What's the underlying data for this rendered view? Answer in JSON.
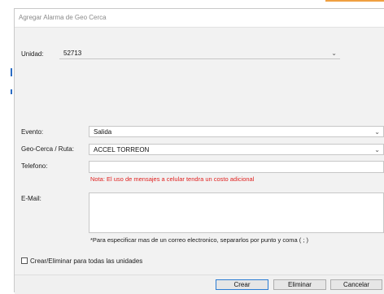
{
  "dialog": {
    "title": "Agregar Alarma de Geo Cerca",
    "unidad": {
      "label": "Unidad:",
      "value": "52713"
    },
    "evento": {
      "label": "Evento:",
      "value": "Salida"
    },
    "geocerca": {
      "label": "Geo-Cerca / Ruta:",
      "value": "ACCEL TORREON"
    },
    "telefono": {
      "label": "Telefono:",
      "value": "",
      "note": "Nota: El uso de mensajes a celular tendra un costo adicional"
    },
    "email": {
      "label": "E-Mail:",
      "value": "",
      "note": "*Para especificar mas de un correo electronico, separarlos por punto y coma ( ; )"
    },
    "checkbox": {
      "label": "Crear/Eliminar para todas las unidades",
      "checked": false
    },
    "buttons": {
      "crear": "Crear",
      "eliminar": "Eliminar",
      "cancelar": "Cancelar"
    }
  },
  "icons": {
    "dropdown": "chevron-down-icon"
  },
  "colors": {
    "note_red": "#e0201e",
    "primary_border": "#2b7cd3"
  }
}
